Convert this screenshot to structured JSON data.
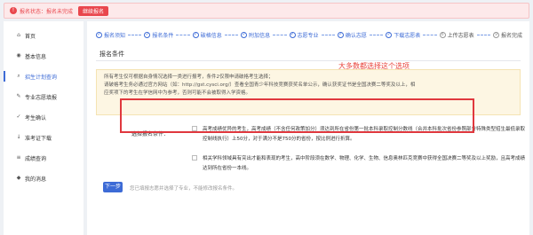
{
  "alert": {
    "icon": "!",
    "text": "报名状态：报名未完成",
    "button": "继续报名"
  },
  "sidebar": {
    "items": [
      {
        "label": "首页",
        "icon": "home-icon",
        "glyph": "⌂"
      },
      {
        "label": "基本信息",
        "icon": "user-icon",
        "glyph": "◉"
      },
      {
        "label": "招生计划查询",
        "icon": "search-icon",
        "glyph": "⌕"
      },
      {
        "label": "专业志愿填报",
        "icon": "edit-icon",
        "glyph": "✎"
      },
      {
        "label": "考生确认",
        "icon": "check-icon",
        "glyph": "✓"
      },
      {
        "label": "准考证下载",
        "icon": "download-icon",
        "glyph": "↓"
      },
      {
        "label": "成绩查询",
        "icon": "chart-icon",
        "glyph": "≡"
      },
      {
        "label": "我的消息",
        "icon": "message-icon",
        "glyph": "◆"
      }
    ]
  },
  "steps": [
    {
      "num": "✓",
      "label": "报名须知"
    },
    {
      "num": "✓",
      "label": "报名条件"
    },
    {
      "num": "✓",
      "label": "破格信息"
    },
    {
      "num": "✓",
      "label": "附加信息"
    },
    {
      "num": "✓",
      "label": "志愿专业"
    },
    {
      "num": "✓",
      "label": "确认志愿"
    },
    {
      "num": "✓",
      "label": "下载志愿表"
    },
    {
      "num": "8",
      "label": "上传志愿表"
    },
    {
      "num": "9",
      "label": "报名完成"
    }
  ],
  "section_title": "报名条件",
  "notice": {
    "line1": "所有考生仅可根据自身情况选择一类进行报考，条件2仅限申请破格考生选择；",
    "line2": "请破格考生务必通过官方网站（如：http://gst.cysci.org/）查看全国青少年科技竞赛获奖名单公示，确认获奖证书是全国决赛二等奖及以上，相",
    "line3": "应奖项下的考生在学信网中为参考，否则可能不会被取得入学资格。"
  },
  "annotation": "大多数都选择这个选项",
  "form": {
    "label": "选择报名条件：",
    "option1": "高考成绩优异的考生，高考成绩（不含任何政策加分）须达到所在省份第一批本科录取控制分数线（合并本科批次省份参照部分特殊类型招生最低录取控制线执行）上50分，对于满分不是750分的省份，按比例进行折算。",
    "option2": "相关学科领域具有突出才能和表现的考生，高中阶段须在数学、物理、化学、生物、信息奥林匹克竞赛中获得全国决赛二等奖及以上奖励，且高考成绩达到所在省份一本线。"
  },
  "submit": "下一步",
  "hint": "您已填报志愿并选择了专业，不能修改报名条件。"
}
